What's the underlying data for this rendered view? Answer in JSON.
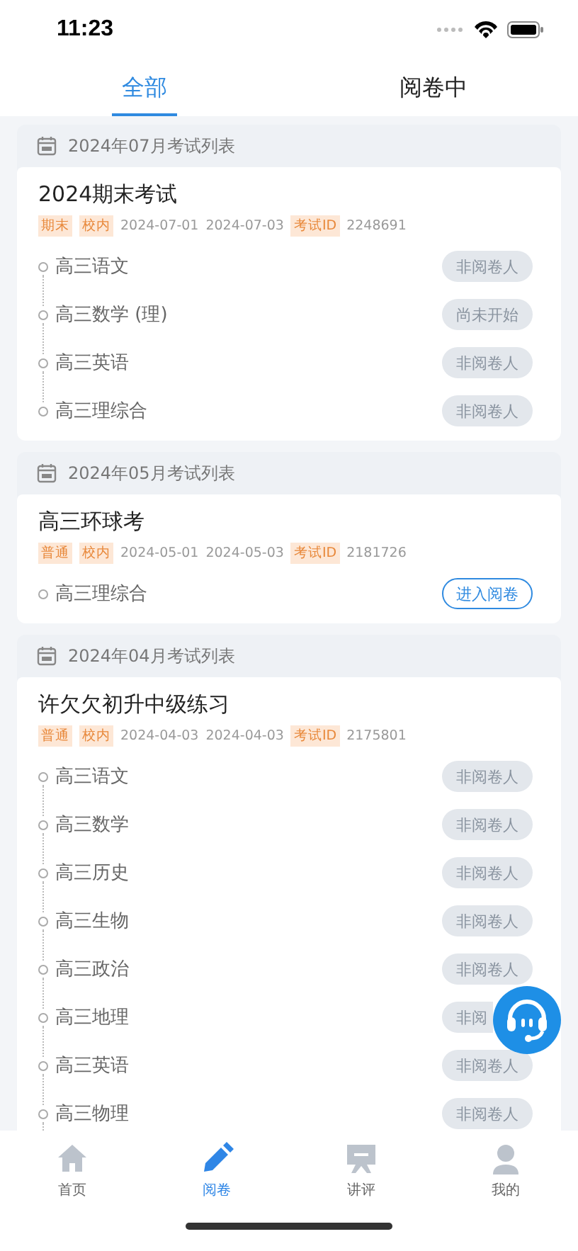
{
  "status_bar": {
    "time": "11:23"
  },
  "tabs": [
    {
      "label": "全部",
      "selected": true
    },
    {
      "label": "阅卷中",
      "selected": false
    }
  ],
  "sections": [
    {
      "heading": "2024年07月考试列表",
      "exam": {
        "title": "2024期末考试",
        "tags": [
          "期末",
          "校内"
        ],
        "start": "2024-07-01",
        "end": "2024-07-03",
        "id_label": "考试ID",
        "id": "2248691",
        "subjects": [
          {
            "name": "高三语文",
            "action": "非阅卷人",
            "enabled": false,
            "covered": false
          },
          {
            "name": "高三数学 (理)",
            "action": "尚未开始",
            "enabled": false,
            "covered": false
          },
          {
            "name": "高三英语",
            "action": "非阅卷人",
            "enabled": false,
            "covered": false
          },
          {
            "name": "高三理综合",
            "action": "非阅卷人",
            "enabled": false,
            "covered": false
          }
        ]
      }
    },
    {
      "heading": "2024年05月考试列表",
      "exam": {
        "title": "高三环球考",
        "tags": [
          "普通",
          "校内"
        ],
        "start": "2024-05-01",
        "end": "2024-05-03",
        "id_label": "考试ID",
        "id": "2181726",
        "subjects": [
          {
            "name": "高三理综合",
            "action": "进入阅卷",
            "enabled": true,
            "covered": false
          }
        ]
      }
    },
    {
      "heading": "2024年04月考试列表",
      "exam": {
        "title": "许欠欠初升中级练习",
        "tags": [
          "普通",
          "校内"
        ],
        "start": "2024-04-03",
        "end": "2024-04-03",
        "id_label": "考试ID",
        "id": "2175801",
        "subjects": [
          {
            "name": "高三语文",
            "action": "非阅卷人",
            "enabled": false,
            "covered": false
          },
          {
            "name": "高三数学",
            "action": "非阅卷人",
            "enabled": false,
            "covered": false
          },
          {
            "name": "高三历史",
            "action": "非阅卷人",
            "enabled": false,
            "covered": false
          },
          {
            "name": "高三生物",
            "action": "非阅卷人",
            "enabled": false,
            "covered": false
          },
          {
            "name": "高三政治",
            "action": "非阅卷人",
            "enabled": false,
            "covered": false
          },
          {
            "name": "高三地理",
            "action": "非阅",
            "enabled": false,
            "covered": true
          },
          {
            "name": "高三英语",
            "action": "非阅卷人",
            "enabled": false,
            "covered": false
          },
          {
            "name": "高三物理",
            "action": "非阅卷人",
            "enabled": false,
            "covered": false
          }
        ]
      }
    }
  ],
  "bottom_nav": [
    {
      "label": "首页",
      "kind": "home",
      "selected": false
    },
    {
      "label": "阅卷",
      "kind": "pencil",
      "selected": true
    },
    {
      "label": "讲评",
      "kind": "board",
      "selected": false
    },
    {
      "label": "我的",
      "kind": "person",
      "selected": false
    }
  ]
}
